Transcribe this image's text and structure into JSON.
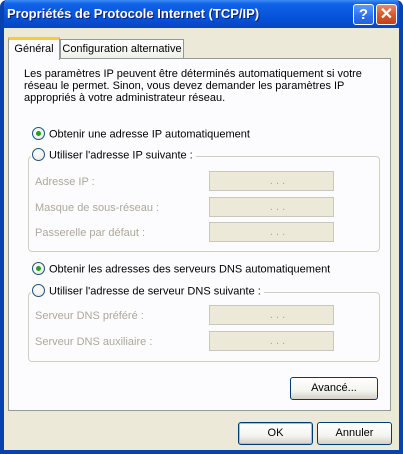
{
  "window": {
    "title": "Propriétés de Protocole Internet (TCP/IP)",
    "help_label": "?",
    "close_label": "✕"
  },
  "tabs": [
    {
      "label": "Général",
      "active": true
    },
    {
      "label": "Configuration alternative",
      "active": false
    }
  ],
  "intro_text": "Les paramètres IP peuvent être déterminés automatiquement si votre réseau le permet. Sinon, vous devez demander les paramètres IP appropriés à votre administrateur réseau.",
  "ip_options": {
    "auto_label": "Obtenir une adresse IP automatiquement",
    "manual_label": "Utiliser l'adresse IP suivante :",
    "selected": "auto",
    "fields": [
      {
        "label": "Adresse IP :",
        "value": ". . ."
      },
      {
        "label": "Masque de sous-réseau :",
        "value": ". . ."
      },
      {
        "label": "Passerelle par défaut :",
        "value": ". . ."
      }
    ]
  },
  "dns_options": {
    "auto_label": "Obtenir les adresses des serveurs DNS automatiquement",
    "manual_label": "Utiliser l'adresse de serveur DNS suivante :",
    "selected": "auto",
    "fields": [
      {
        "label": "Serveur DNS préféré :",
        "value": ". . ."
      },
      {
        "label": "Serveur DNS auxiliaire :",
        "value": ". . ."
      }
    ]
  },
  "buttons": {
    "advanced": "Avancé...",
    "ok": "OK",
    "cancel": "Annuler"
  },
  "colors": {
    "titlebar": "#0a5adf",
    "window_bg": "#ece9d8",
    "disabled_text": "#aca899",
    "radio_dot": "#21a121",
    "active_tab_accent": "#ffc83c"
  }
}
